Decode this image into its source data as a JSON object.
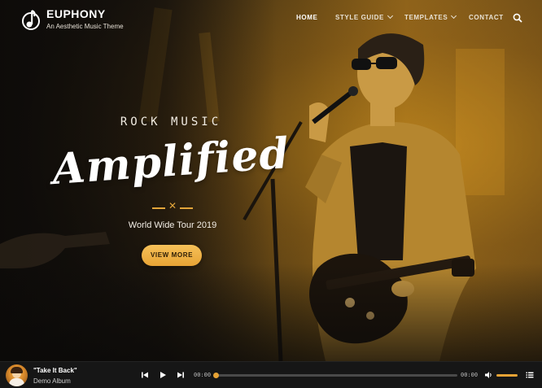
{
  "site": {
    "title": "EUPHONY",
    "tagline": "An Aesthetic Music Theme"
  },
  "nav": {
    "items": [
      {
        "label": "HOME",
        "active": true,
        "dropdown": false
      },
      {
        "label": "STYLE GUIDE",
        "active": false,
        "dropdown": true
      },
      {
        "label": "TEMPLATES",
        "active": false,
        "dropdown": true
      },
      {
        "label": "CONTACT",
        "active": false,
        "dropdown": false
      }
    ],
    "search_icon": "search-icon"
  },
  "hero": {
    "subtitle": "ROCK MUSIC",
    "title": "Amplified",
    "tour": "World Wide Tour 2019",
    "cta_label": "VIEW MORE"
  },
  "player": {
    "track_title": "\"Take It Back\"",
    "album": "Demo Album",
    "current_time": "00:00",
    "duration": "00:00",
    "progress": 0,
    "volume": 1.0
  },
  "colors": {
    "accent": "#e7a335",
    "player_bg": "#161616"
  }
}
